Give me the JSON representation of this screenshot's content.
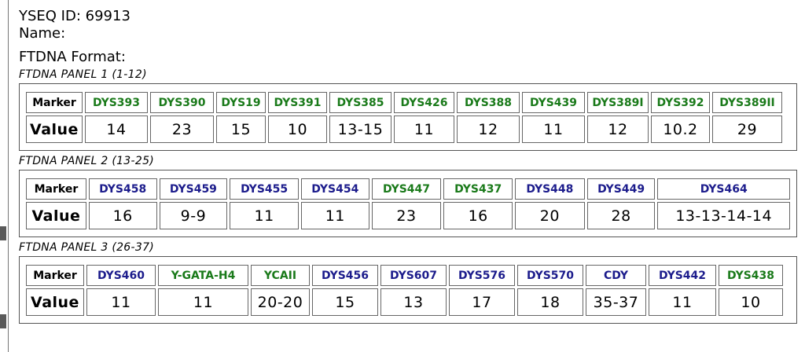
{
  "header": {
    "yseq_label": "YSEQ ID:",
    "yseq_id": "69913",
    "name_label": "Name:",
    "format_label": "FTDNA Format:"
  },
  "colors": {
    "green": "#1a7a1a",
    "blue": "#1c1c8c"
  },
  "labels": {
    "marker": "Marker",
    "value": "Value"
  },
  "panels": [
    {
      "title": "FTDNA PANEL 1 (1-12)",
      "markers": [
        {
          "name": "DYS393",
          "value": "14",
          "color": "green"
        },
        {
          "name": "DYS390",
          "value": "23",
          "color": "green"
        },
        {
          "name": "DYS19",
          "value": "15",
          "color": "green"
        },
        {
          "name": "DYS391",
          "value": "10",
          "color": "green"
        },
        {
          "name": "DYS385",
          "value": "13-15",
          "color": "green"
        },
        {
          "name": "DYS426",
          "value": "11",
          "color": "green"
        },
        {
          "name": "DYS388",
          "value": "12",
          "color": "green"
        },
        {
          "name": "DYS439",
          "value": "11",
          "color": "green"
        },
        {
          "name": "DYS389I",
          "value": "12",
          "color": "green"
        },
        {
          "name": "DYS392",
          "value": "10.2",
          "color": "green"
        },
        {
          "name": "DYS389II",
          "value": "29",
          "color": "green"
        }
      ]
    },
    {
      "title": "FTDNA PANEL 2 (13-25)",
      "markers": [
        {
          "name": "DYS458",
          "value": "16",
          "color": "blue"
        },
        {
          "name": "DYS459",
          "value": "9-9",
          "color": "blue"
        },
        {
          "name": "DYS455",
          "value": "11",
          "color": "blue"
        },
        {
          "name": "DYS454",
          "value": "11",
          "color": "blue"
        },
        {
          "name": "DYS447",
          "value": "23",
          "color": "green"
        },
        {
          "name": "DYS437",
          "value": "16",
          "color": "green"
        },
        {
          "name": "DYS448",
          "value": "20",
          "color": "blue"
        },
        {
          "name": "DYS449",
          "value": "28",
          "color": "blue"
        },
        {
          "name": "DYS464",
          "value": "13-13-14-14",
          "color": "blue"
        }
      ]
    },
    {
      "title": "FTDNA PANEL 3 (26-37)",
      "markers": [
        {
          "name": "DYS460",
          "value": "11",
          "color": "blue"
        },
        {
          "name": "Y-GATA-H4",
          "value": "11",
          "color": "green"
        },
        {
          "name": "YCAII",
          "value": "20-20",
          "color": "green"
        },
        {
          "name": "DYS456",
          "value": "15",
          "color": "blue"
        },
        {
          "name": "DYS607",
          "value": "13",
          "color": "blue"
        },
        {
          "name": "DYS576",
          "value": "17",
          "color": "blue"
        },
        {
          "name": "DYS570",
          "value": "18",
          "color": "blue"
        },
        {
          "name": "CDY",
          "value": "35-37",
          "color": "blue"
        },
        {
          "name": "DYS442",
          "value": "11",
          "color": "blue"
        },
        {
          "name": "DYS438",
          "value": "10",
          "color": "green"
        }
      ]
    }
  ]
}
